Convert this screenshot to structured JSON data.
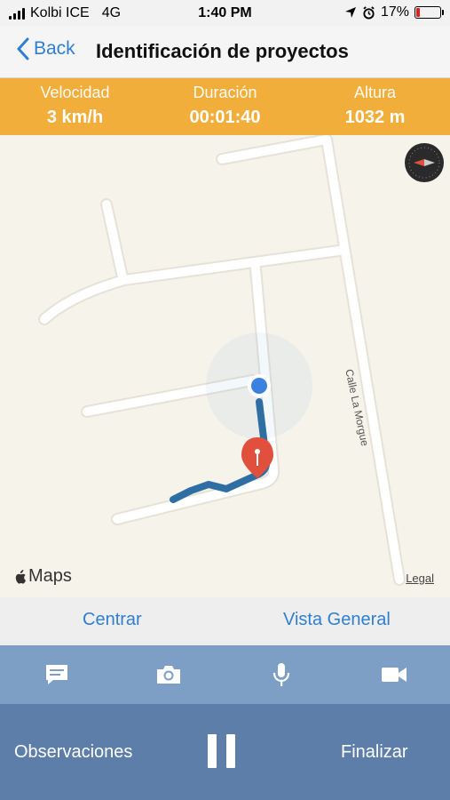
{
  "status_bar": {
    "carrier": "Kolbi ICE",
    "network": "4G",
    "time": "1:40 PM",
    "battery_percent": "17%",
    "battery_level": 0.17,
    "battery_color": "#e02020"
  },
  "nav": {
    "back_label": "Back",
    "title": "Identificación de proyectos"
  },
  "stats": {
    "accent": "#f2ae3a",
    "items": [
      {
        "label": "Velocidad",
        "value": "3 km/h"
      },
      {
        "label": "Duración",
        "value": "00:01:40"
      },
      {
        "label": "Altura",
        "value": "1032 m"
      }
    ]
  },
  "map": {
    "road_label": "Calle La Morgue",
    "maps_brand": "Maps",
    "legal": "Legal",
    "route_color": "#2f6ea3",
    "pin_color": "#e0503c",
    "location_color": "#3b82e0",
    "compass_icon": "compass-icon",
    "compass_letter": "N"
  },
  "view_controls": {
    "center_label": "Centrar",
    "overview_label": "Vista General"
  },
  "media_toolbar": {
    "icons": [
      "comment-icon",
      "camera-icon",
      "microphone-icon",
      "video-camera-icon"
    ]
  },
  "actions": {
    "observations_label": "Observaciones",
    "finish_label": "Finalizar",
    "pause_icon": "pause-icon"
  }
}
